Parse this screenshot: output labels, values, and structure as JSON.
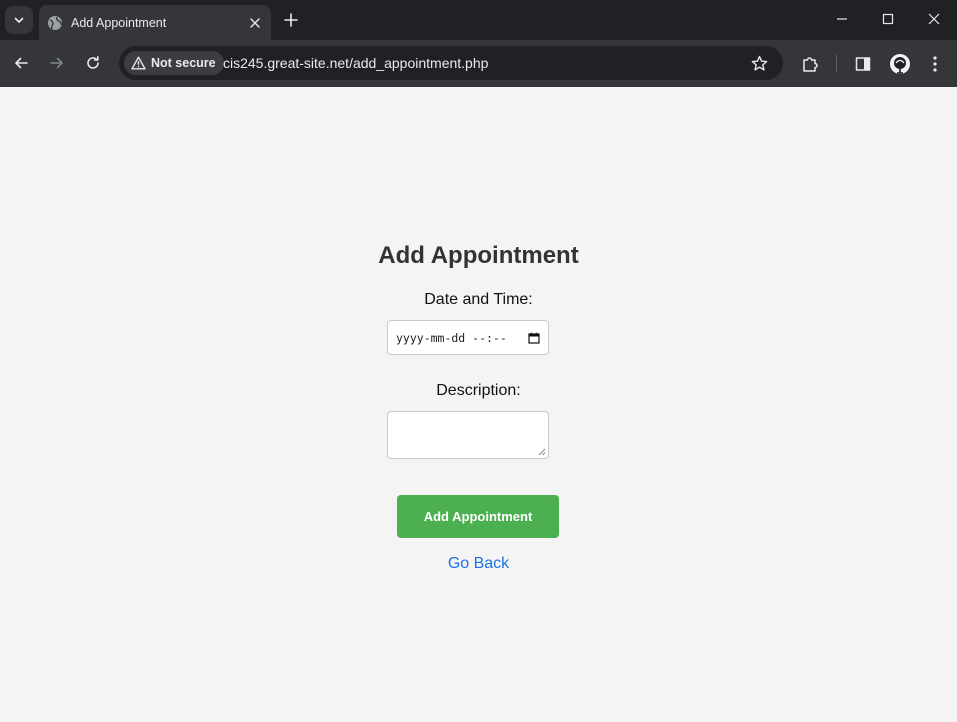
{
  "browser": {
    "tab_title": "Add Appointment",
    "security_label": "Not secure",
    "url": "cis245.great-site.net/add_appointment.php"
  },
  "page": {
    "heading": "Add Appointment",
    "datetime_label": "Date and Time:",
    "datetime_placeholder": "yyyy-mm-dd --:--",
    "description_label": "Description:",
    "description_value": "",
    "submit_label": "Add Appointment",
    "back_link": "Go Back"
  },
  "colors": {
    "page_background": "#f4f4f4",
    "submit_button": "#4caf50",
    "link": "#1a73e8",
    "browser_frame": "#202124",
    "browser_toolbar": "#35363a"
  },
  "icons": [
    "chevron-down-icon",
    "globe-icon",
    "close-icon",
    "plus-icon",
    "minimize-icon",
    "maximize-icon",
    "back-arrow-icon",
    "forward-arrow-icon",
    "reload-icon",
    "warning-icon",
    "star-icon",
    "puzzle-icon",
    "side-panel-icon",
    "profile-icon",
    "more-vert-icon",
    "calendar-icon"
  ]
}
